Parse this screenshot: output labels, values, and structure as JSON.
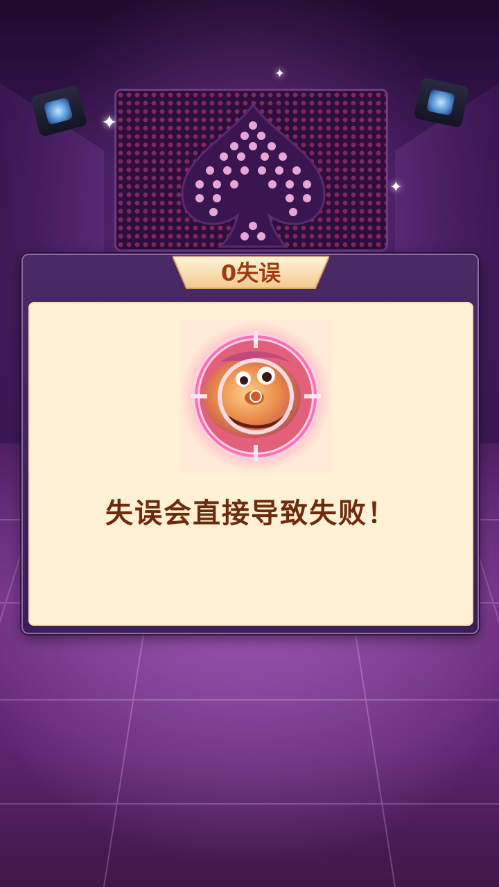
{
  "dialog": {
    "title": "0失误",
    "message": "失误会直接导致失败！"
  },
  "emblem": {
    "icon": "crosshair-monster-icon",
    "ring_color": "#ff5fa8"
  },
  "colors": {
    "panel_bg": "#fff2d4",
    "title_text": "#a23a0c",
    "message_text": "#6e2a0c",
    "frame": "#3a1e55"
  }
}
